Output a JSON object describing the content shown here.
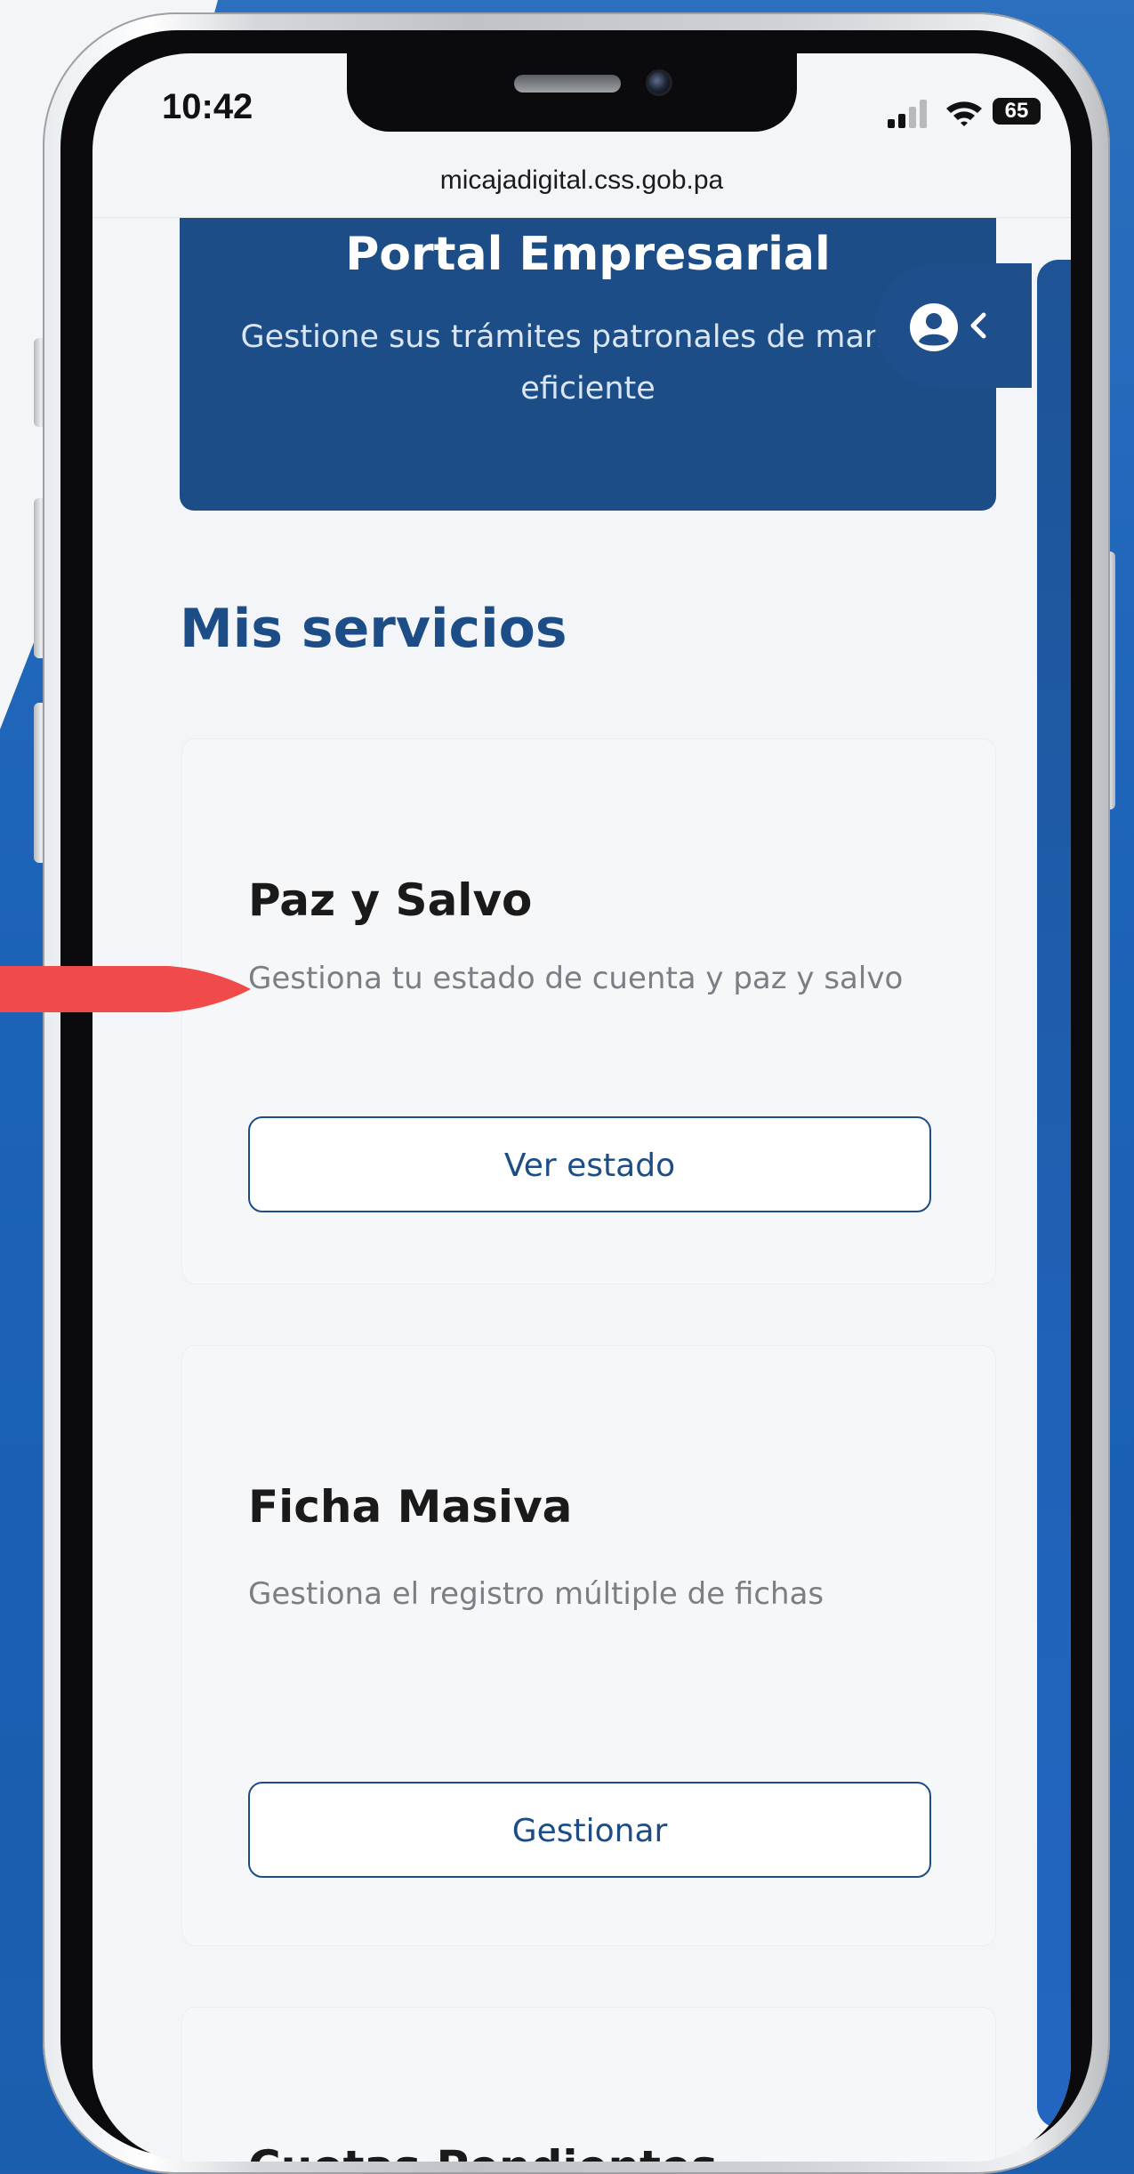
{
  "status_bar": {
    "time": "10:42",
    "battery": "65"
  },
  "browser": {
    "url": "micajadigital.css.gob.pa"
  },
  "hero": {
    "title": "Portal Empresarial",
    "subtitle": "Gestione sus trámites patronales de manera eficiente"
  },
  "side_toggle": {
    "icons": [
      "user-circle-icon",
      "chevron-left-icon"
    ]
  },
  "main": {
    "section_title": "Mis servicios",
    "cards": [
      {
        "title": "Paz y Salvo",
        "description": "Gestiona tu estado de cuenta y paz y salvo",
        "button": "Ver estado"
      },
      {
        "title": "Ficha Masiva",
        "description": "Gestiona el registro múltiple de fichas",
        "button": "Gestionar"
      },
      {
        "title": "Cuotas Pendientes"
      }
    ]
  },
  "colors": {
    "primary": "#1c4d86",
    "background": "#f4f5f8",
    "arrow": "#f04a4a"
  }
}
